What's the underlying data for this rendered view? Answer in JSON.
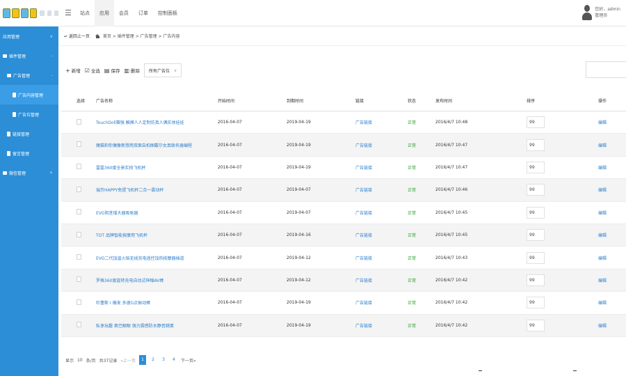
{
  "topbar": {
    "nav": [
      "站点",
      "应用",
      "会员",
      "订单",
      "控制面板"
    ],
    "active_nav": 1,
    "user_greeting": "您好，admin",
    "user_role": "管理员"
  },
  "sidebar": {
    "items": [
      {
        "label": "应用管理",
        "level": 0,
        "toggle": "∨"
      },
      {
        "label": "插件管理",
        "level": 0,
        "toggle": "-"
      },
      {
        "label": "广告管理",
        "level": 1,
        "toggle": "-"
      },
      {
        "label": "广告内容管理",
        "level": 2,
        "active": true
      },
      {
        "label": "广告位管理",
        "level": 2
      },
      {
        "label": "链接管理",
        "level": 1
      },
      {
        "label": "留言管理",
        "level": 1
      },
      {
        "label": "微信管理",
        "level": 0,
        "toggle": "+"
      }
    ]
  },
  "breadcrumb": {
    "back": "返回上一页",
    "trail": "首页 > 插件管理 > 广告管理 > 广告内容"
  },
  "toolbar": {
    "add": "新增",
    "select_all": "全选",
    "save": "保存",
    "delete": "删除",
    "position_select": "所有广告位"
  },
  "table": {
    "headers": [
      "选择",
      "广告名称",
      "开始时间",
      "到期时间",
      "链接",
      "状态",
      "发布时间",
      "排序",
      "操作"
    ],
    "rows": [
      {
        "name": "TouchDoll赛强 触摸人人定制仿真人偶实体娃娃",
        "start": "2016-04-07",
        "end": "2019-04-19",
        "link": "广告链接",
        "status": "正常",
        "pub": "2016/4/7 10:48",
        "sort": "99",
        "op": "编辑"
      },
      {
        "name": "魔猫和你偶像新想用双面自拍图戴尔女真联名器编程",
        "start": "2016-04-07",
        "end": "2019-04-19",
        "link": "广告链接",
        "status": "正常",
        "pub": "2016/4/7 10:47",
        "sort": "99",
        "op": "编辑"
      },
      {
        "name": "雷霆360度全景实拍飞机杯",
        "start": "2016-04-07",
        "end": "2019-04-19",
        "link": "广告链接",
        "status": "正常",
        "pub": "2016/4/7 10:47",
        "sort": "99",
        "op": "编辑"
      },
      {
        "name": "瑞芬HAPPY免提飞机杯二合一震动杯",
        "start": "2016-04-07",
        "end": "2019-04-07",
        "link": "广告链接",
        "status": "正常",
        "pub": "2016/4/7 10:46",
        "sort": "99",
        "op": "编辑"
      },
      {
        "name": "EVO阴茎增大器吸吮器",
        "start": "2016-04-07",
        "end": "2019-04-07",
        "link": "广告链接",
        "status": "正常",
        "pub": "2016/4/7 10:45",
        "sort": "99",
        "op": "编辑"
      },
      {
        "name": "TOT 品牌智能按摩用飞机杯",
        "start": "2016-04-07",
        "end": "2019-04-16",
        "link": "广告链接",
        "status": "正常",
        "pub": "2016/4/7 10:45",
        "sort": "99",
        "op": "编辑"
      },
      {
        "name": "EVO二代加温火焰无线充电遥控加热按摩器插道",
        "start": "2016-04-07",
        "end": "2019-04-12",
        "link": "广告链接",
        "status": "正常",
        "pub": "2016/4/7 10:43",
        "sort": "99",
        "op": "编辑"
      },
      {
        "name": "罗格360度旋转充电自动式伸缩AV棒",
        "start": "2016-04-07",
        "end": "2019-04-12",
        "link": "广告链接",
        "status": "正常",
        "pub": "2016/4/7 10:42",
        "sort": "99",
        "op": "编辑"
      },
      {
        "name": "杜蕾斯 I 爆发 多速G点振动棒",
        "start": "2016-04-07",
        "end": "2019-04-19",
        "link": "广告链接",
        "status": "正常",
        "pub": "2016/4/7 10:42",
        "sort": "99",
        "op": "编辑"
      },
      {
        "name": "私享玩趣 奥巴眼眼 强力震感防水静音跳蛋",
        "start": "2016-04-07",
        "end": "2019-04-19",
        "link": "广告链接",
        "status": "正常",
        "pub": "2016/4/7 10:42",
        "sort": "99",
        "op": "编辑"
      }
    ]
  },
  "pager": {
    "show": "显示",
    "per_page": "10",
    "per_page_unit": "条/页",
    "total": "共37记录",
    "prev": "«上一页",
    "pages": [
      "1",
      "2",
      "3",
      "4"
    ],
    "current": "1",
    "next": "下一页»"
  },
  "colors": {
    "sidebar_bg": "#2b8ed7",
    "link": "#2b7dcc",
    "status_ok": "#2ea12e"
  }
}
